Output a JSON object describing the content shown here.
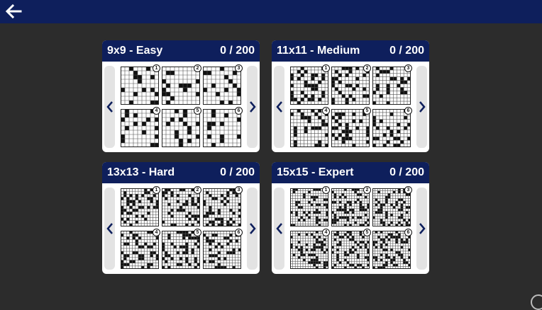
{
  "toolbar": {
    "back_icon": "arrow-left-icon"
  },
  "colors": {
    "header": "#0e1f5c",
    "background": "#2c2c2c",
    "panel": "#ffffff",
    "nav": "#e3e3e3"
  },
  "panels": [
    {
      "title": "9x9 - Easy",
      "progress": "0 / 200",
      "size": 9,
      "puzzles": [
        "1",
        "2",
        "3",
        "4",
        "5",
        "6"
      ]
    },
    {
      "title": "11x11 - Medium",
      "progress": "0 / 200",
      "size": 11,
      "puzzles": [
        "1",
        "2",
        "3",
        "4",
        "5",
        "6"
      ]
    },
    {
      "title": "13x13 - Hard",
      "progress": "0 / 200",
      "size": 13,
      "puzzles": [
        "1",
        "2",
        "3",
        "4",
        "5",
        "6"
      ]
    },
    {
      "title": "15x15 - Expert",
      "progress": "0 / 200",
      "size": 15,
      "puzzles": [
        "1",
        "2",
        "3",
        "4",
        "5",
        "6"
      ]
    }
  ]
}
